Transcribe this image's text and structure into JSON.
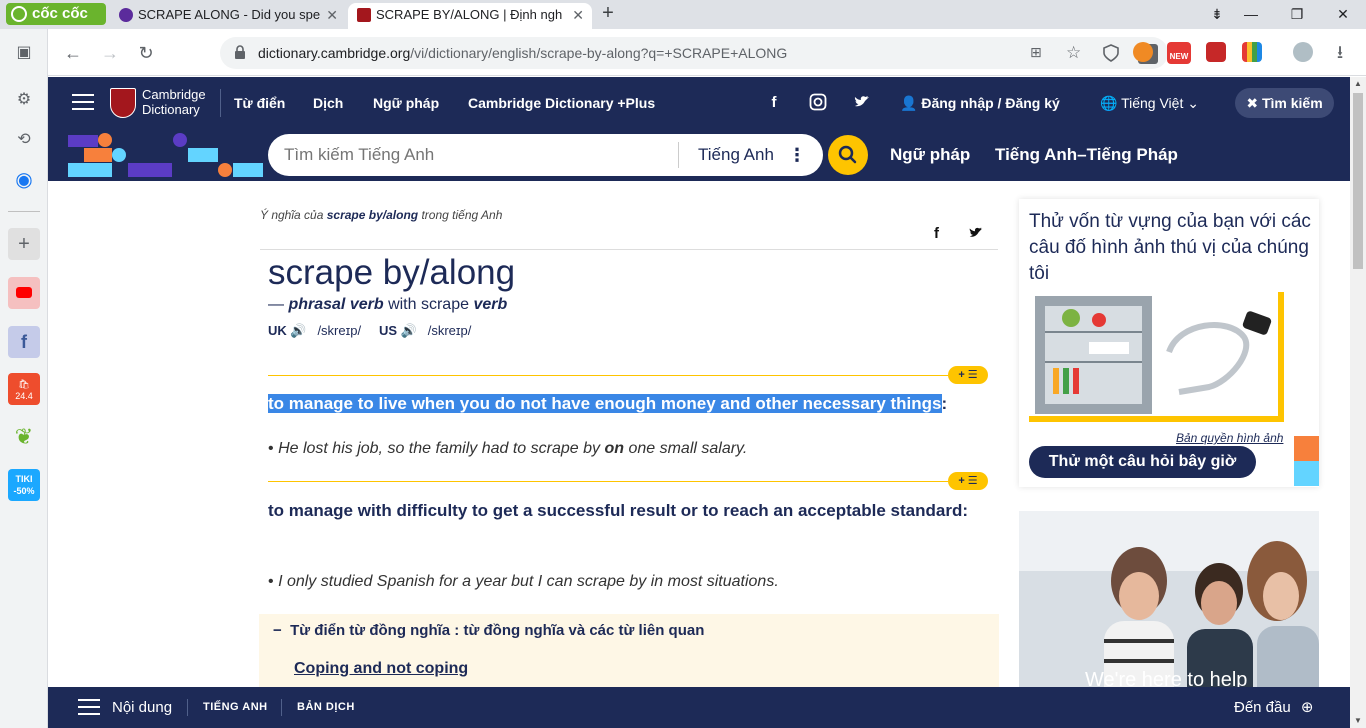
{
  "browser": {
    "brand": "cốc cốc",
    "tabs": [
      {
        "title": "SCRAPE ALONG - Did you spe",
        "active": false
      },
      {
        "title": "SCRAPE BY/ALONG | Định ngh",
        "active": true
      }
    ],
    "url_host": "dictionary.cambridge.org",
    "url_path": "/vi/dictionary/english/scrape-by-along?q=+SCRAPE+ALONG",
    "badge_new": "NEW"
  },
  "sidebar": {
    "badges": {
      "shopee": "24.4",
      "tiki": "TIKI",
      "tiki_discount": "-50%"
    }
  },
  "header": {
    "logo_line1": "Cambridge",
    "logo_line2": "Dictionary",
    "nav": [
      "Từ điển",
      "Dịch",
      "Ngữ pháp",
      "Cambridge Dictionary +Plus"
    ],
    "login": "Đăng nhập / Đăng ký",
    "language": "Tiếng Việt",
    "search_close": "Tìm kiếm"
  },
  "searchbar": {
    "placeholder": "Tìm kiếm Tiếng Anh",
    "dict_lang": "Tiếng Anh",
    "links": [
      "Ngữ pháp",
      "Tiếng Anh–Tiếng Pháp"
    ]
  },
  "entry": {
    "crumb_prefix": "Ý nghĩa của",
    "crumb_word": "scrape by/along",
    "crumb_suffix": "trong tiếng Anh",
    "headword": "scrape by/along",
    "pos_dash": "—",
    "pos": "phrasal verb",
    "pos_with": "with scrape",
    "pos_verb": "verb",
    "uk_label": "UK",
    "uk_ipa": "/skreɪp/",
    "us_label": "US",
    "us_ipa": "/skreɪp/",
    "pill_label": "+ ☰",
    "def1": "to manage to live when you do not have enough money and other necessary things",
    "def1_colon": ":",
    "ex1_pre": "He lost his job, so the family had to scrape by",
    "ex1_bold": "on",
    "ex1_post": "one small salary.",
    "def2": "to manage with difficulty to get a successful result or to reach an acceptable standard:",
    "ex2": "I only studied Spanish for a year but I can scrape by in most situations.",
    "bullet": "•"
  },
  "thesaurus": {
    "minus": "−",
    "title": "Từ điển từ đồng nghĩa : từ đồng nghĩa và các từ liên quan",
    "link": "Coping and not coping"
  },
  "quiz": {
    "title": "Thử vốn từ vựng của bạn với các câu đố hình ảnh thú vị của chúng tôi",
    "copyright": "Bản quyền hình ảnh",
    "button": "Thử một câu hỏi bây giờ"
  },
  "promo": {
    "text": "We're here to help"
  },
  "footer": {
    "contents": "Nội dung",
    "tab1": "TIẾNG ANH",
    "tab2": "BẢN DỊCH",
    "top": "Đến đầu"
  },
  "colors": {
    "navy": "#1d2a57",
    "yellow": "#fec400",
    "highlight": "#3a87e6",
    "cococ_green": "#6ab42d"
  }
}
